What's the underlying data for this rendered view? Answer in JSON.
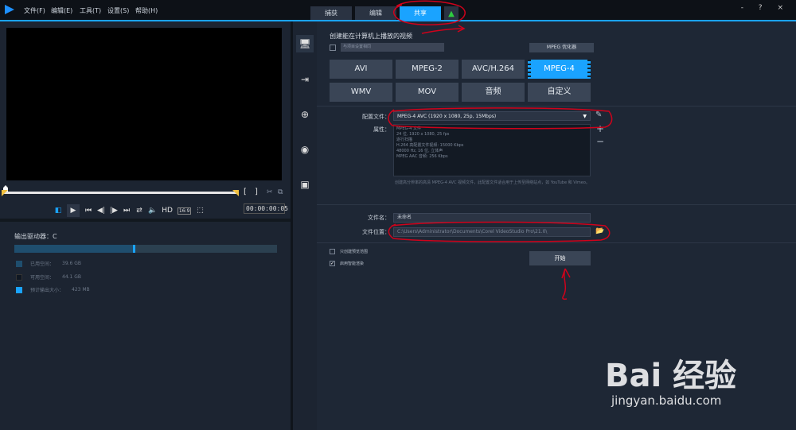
{
  "menu": {
    "items": [
      "文件(F)",
      "编辑(E)",
      "工具(T)",
      "设置(S)",
      "帮助(H)"
    ]
  },
  "tabs": [
    {
      "label": "捕获"
    },
    {
      "label": "编辑"
    },
    {
      "label": "共享"
    }
  ],
  "active_tab": "共享",
  "window_controls": "- ? ×",
  "player": {
    "hd_label": "HD",
    "aspect_label": "16:9",
    "timecode": "00:00:00:05",
    "bracket_in": "[",
    "bracket_out": "]"
  },
  "drive": {
    "label": "输出驱动器：C",
    "used_fraction": 0.45,
    "legend": [
      {
        "label": "已用空间：",
        "value": "39.6 GB",
        "color": "#1f4e6e"
      },
      {
        "label": "可用空间：",
        "value": "44.1 GB",
        "color": "#0f1722"
      },
      {
        "label": "预计输出大小：",
        "value": "423 MB",
        "color": "#1aa3ff"
      }
    ]
  },
  "share": {
    "heading": "创建能在计算机上播放的视频",
    "device_placeholder": "与项目设置相同",
    "mpeg_optimizer": "MPEG 优化器",
    "formats": [
      "AVI",
      "MPEG-2",
      "AVC/H.264",
      "MPEG-4",
      "WMV",
      "MOV",
      "音频",
      "自定义"
    ],
    "selected_format": "MPEG-4",
    "profile_label": "配置文件：",
    "profile_value": "MPEG-4 AVC (1920 x 1080, 25p, 15Mbps)",
    "properties_label": "属性：",
    "properties": [
      "MPEG-4 文件",
      "24 位, 1920 x 1080, 25 fps",
      "逐行扫描",
      "H.264 高配置文件视频: 15000 Kbps",
      "48000 Hz, 16 位, 立体声",
      "MPEG AAC 音频: 256 Kbps"
    ],
    "description": "创建高分辨率的高清 MPEG-4 AVC 视频文件，此配置文件适合用于上传至网络站点，如 YouTube 和 Vimeo。",
    "filename_label": "文件名：",
    "filename_value": "未命名",
    "location_label": "文件位置：",
    "location_value": "C:\\Users\\Administrator\\Documents\\Corel VideoStudio Pro\\21.0\\",
    "option_preview_range": "只创建预览范围",
    "option_smart_render": "启用智能渲染",
    "start_button": "开始"
  },
  "watermark": {
    "brand": "Bai 经验",
    "url": "jingyan.baidu.com"
  },
  "annotation_color": "#d0021b"
}
